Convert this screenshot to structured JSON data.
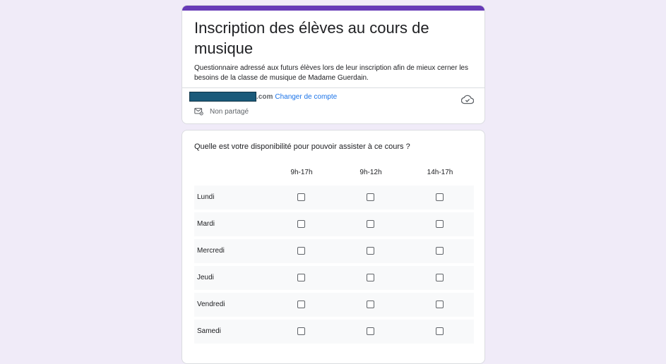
{
  "form": {
    "title": "Inscription des élèves au cours de musique",
    "description": "Questionnaire adressé aux futurs élèves lors de leur inscription afin de mieux cerner les besoins de la classe de musique de Madame Guerdain.",
    "accent_color": "#673ab7",
    "background_color": "#f0ebf8"
  },
  "account": {
    "email_suffix": ".com",
    "change_label": "Changer de compte",
    "share_status": "Non partagé",
    "cloud_icon": "cloud-icon",
    "mail_icon": "mail-icon"
  },
  "question": {
    "title": "Quelle est votre disponibilité pour pouvoir assister à ce cours ?",
    "columns": [
      "9h-17h",
      "9h-12h",
      "14h-17h"
    ],
    "rows": [
      "Lundi",
      "Mardi",
      "Mercredi",
      "Jeudi",
      "Vendredi",
      "Samedi"
    ]
  }
}
